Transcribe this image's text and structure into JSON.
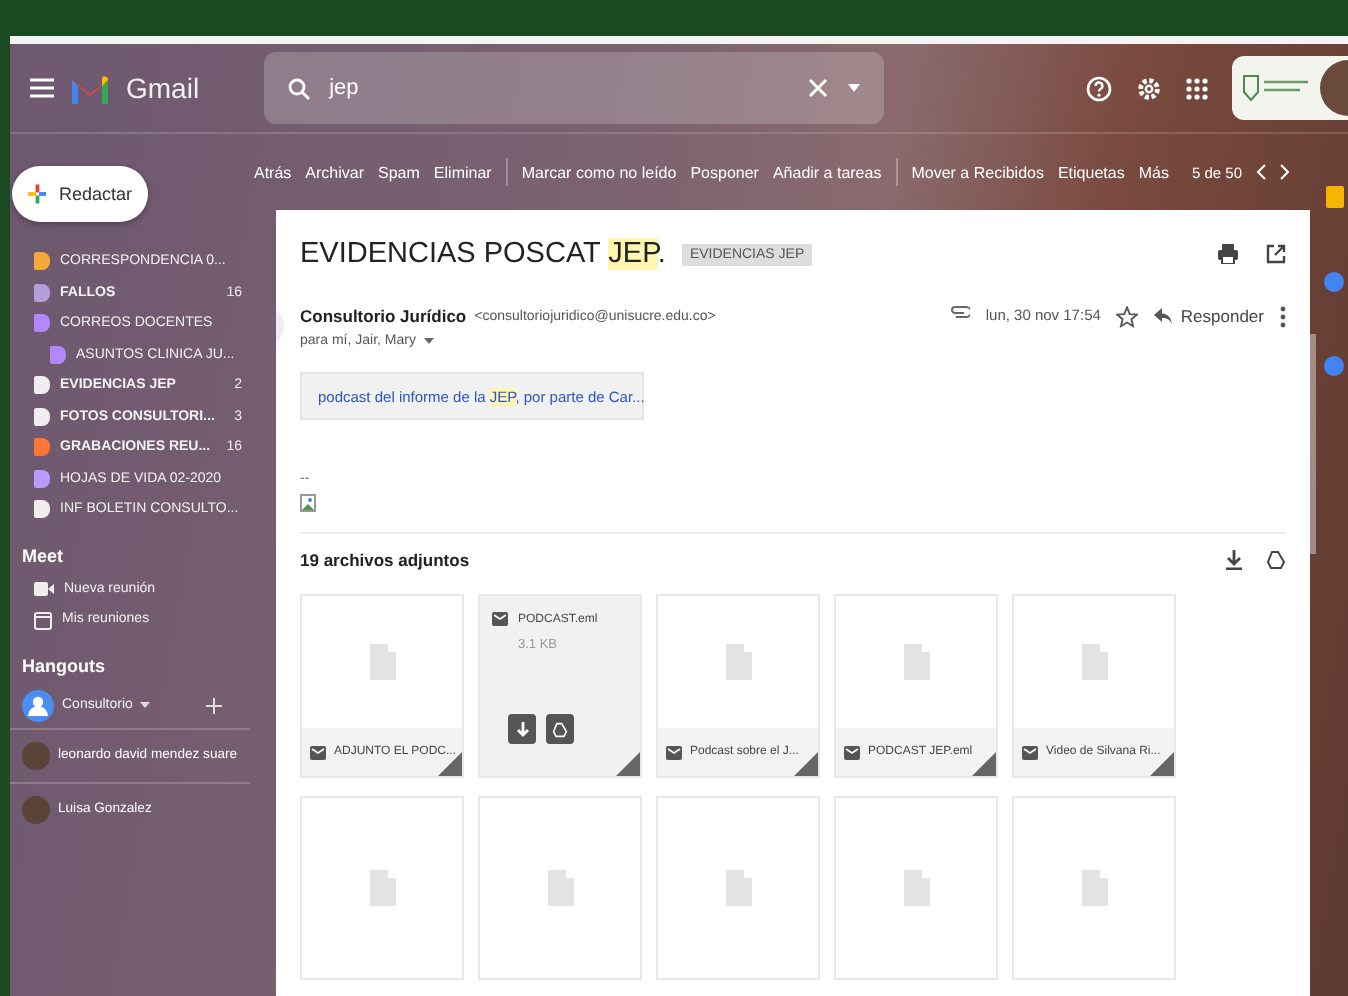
{
  "header": {
    "app_name": "Gmail",
    "search": {
      "value": "jep"
    }
  },
  "compose": {
    "label": "Redactar"
  },
  "labels": [
    {
      "name": "CORRESPONDENCIA 0...",
      "color": "#f4a83a",
      "bold": false
    },
    {
      "name": "FALLOS",
      "color": "#b39ddb",
      "count": "16",
      "bold": true
    },
    {
      "name": "CORREOS DOCENTES",
      "color": "#b388ff",
      "bold": false,
      "children": [
        {
          "name": "ASUNTOS CLINICA JU...",
          "color": "#b388ff",
          "bold": false
        }
      ]
    },
    {
      "name": "EVIDENCIAS JEP",
      "color": "#eeeeee",
      "count": "2",
      "bold": true
    },
    {
      "name": "FOTOS CONSULTORI...",
      "color": "#eeeeee",
      "count": "3",
      "bold": true
    },
    {
      "name": "GRABACIONES REU...",
      "color": "#ff7537",
      "count": "16",
      "bold": true
    },
    {
      "name": "HOJAS DE VIDA 02-2020",
      "color": "#b99aff",
      "bold": false
    },
    {
      "name": "INF BOLETIN CONSULTO...",
      "color": "#eeeeee",
      "bold": false
    }
  ],
  "meet": {
    "title": "Meet",
    "items": [
      {
        "kind": "video",
        "label": "Nueva reunión"
      },
      {
        "kind": "calendar",
        "label": "Mis reuniones"
      }
    ]
  },
  "hangouts": {
    "title": "Hangouts",
    "user": "Consultorio",
    "contacts": [
      "leonardo david mendez suare",
      "Luisa Gonzalez"
    ]
  },
  "toolbar": {
    "actions": [
      [
        "Atrás",
        "Archivar",
        "Spam",
        "Eliminar"
      ],
      [
        "Marcar como no leído",
        "Posponer",
        "Añadir a tareas"
      ],
      [
        "Mover a Recibidos",
        "Etiquetas",
        "Más"
      ]
    ],
    "pager": "5 de 50"
  },
  "email": {
    "subject": [
      {
        "text": "EVIDENCIAS POSCAT ",
        "highlight": false
      },
      {
        "text": "JEP",
        "highlight": true
      },
      {
        "text": ".",
        "highlight": false
      }
    ],
    "label_chip": "EVIDENCIAS JEP",
    "sender_name": "Consultorio Jurídico",
    "sender_email": "<consultoriojuridico@unisucre.edu.co>",
    "recipients": "para mí, Jair, Mary",
    "date": "lun, 30 nov 17:54",
    "reply": "Responder",
    "link": [
      {
        "text": "podcast del informe de la ",
        "highlight": false
      },
      {
        "text": "JEP",
        "highlight": true
      },
      {
        "text": ", por parte de Car...",
        "highlight": false
      }
    ],
    "signature": "--",
    "attachments_title": "19 archivos adjuntos",
    "attachments": [
      {
        "name": "ADJUNTO EL PODC...",
        "hovered": false
      },
      {
        "name": "PODCAST.eml",
        "size": "3.1 KB",
        "hovered": true
      },
      {
        "name": "Podcast sobre el J...",
        "hovered": false
      },
      {
        "name": "PODCAST JEP.eml",
        "hovered": false
      },
      {
        "name": "Video de Silvana Ri...",
        "hovered": false
      },
      {
        "hovered": false
      },
      {
        "hovered": false
      },
      {
        "hovered": false
      },
      {
        "hovered": false
      },
      {
        "hovered": false
      }
    ]
  }
}
